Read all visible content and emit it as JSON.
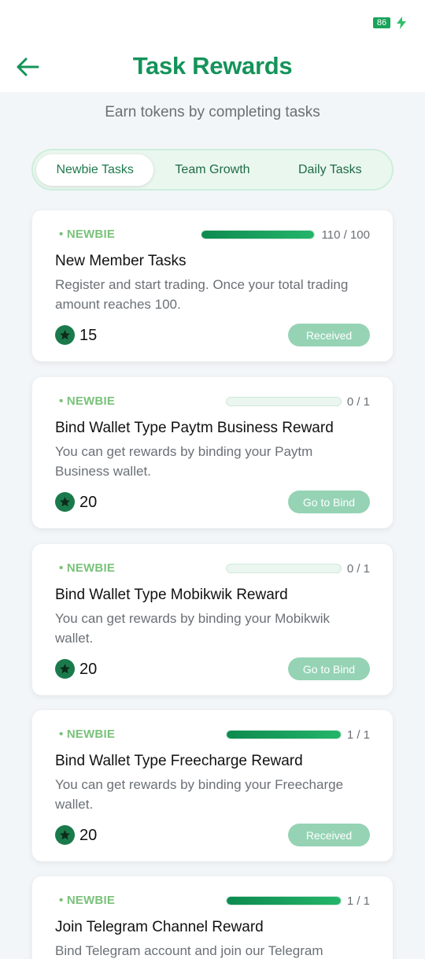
{
  "status": {
    "battery": "86"
  },
  "header": {
    "title": "Task Rewards",
    "subtitle": "Earn tokens by completing tasks"
  },
  "tabs": [
    {
      "label": "Newbie Tasks",
      "active": true
    },
    {
      "label": "Team Growth",
      "active": false
    },
    {
      "label": "Daily Tasks",
      "active": false
    }
  ],
  "tasks": [
    {
      "badge": "• NEWBIE",
      "progress_text": "110 / 100",
      "progress_fraction": 1.0,
      "title": "New Member Tasks",
      "description": "Register and start trading. Once your total trading amount reaches 100.",
      "reward": "15",
      "button": "Received"
    },
    {
      "badge": "• NEWBIE",
      "progress_text": "0 / 1",
      "progress_fraction": 0,
      "title": "Bind Wallet Type Paytm Business Reward",
      "description": "You can get rewards by binding your Paytm Business wallet.",
      "reward": "20",
      "button": "Go to Bind"
    },
    {
      "badge": "• NEWBIE",
      "progress_text": "0 / 1",
      "progress_fraction": 0,
      "title": "Bind Wallet Type Mobikwik Reward",
      "description": "You can get rewards by binding your Mobikwik wallet.",
      "reward": "20",
      "button": "Go to Bind"
    },
    {
      "badge": "• NEWBIE",
      "progress_text": "1 / 1",
      "progress_fraction": 1.0,
      "title": "Bind Wallet Type Freecharge Reward",
      "description": "You can get rewards by binding your Freecharge wallet.",
      "reward": "20",
      "button": "Received"
    },
    {
      "badge": "• NEWBIE",
      "progress_text": "1 / 1",
      "progress_fraction": 1.0,
      "title": "Join Telegram Channel Reward",
      "description": "Bind Telegram account and join our Telegram",
      "reward": "",
      "button": ""
    }
  ],
  "colors": {
    "accent": "#14935a",
    "badge": "#79c27a",
    "button_bg": "#95d3b4",
    "coin": "#1b7a4b"
  },
  "icons": {
    "back": "arrow-left-icon",
    "battery": "battery-icon",
    "charging": "lightning-bolt-icon",
    "reward": "star-coin-icon"
  }
}
